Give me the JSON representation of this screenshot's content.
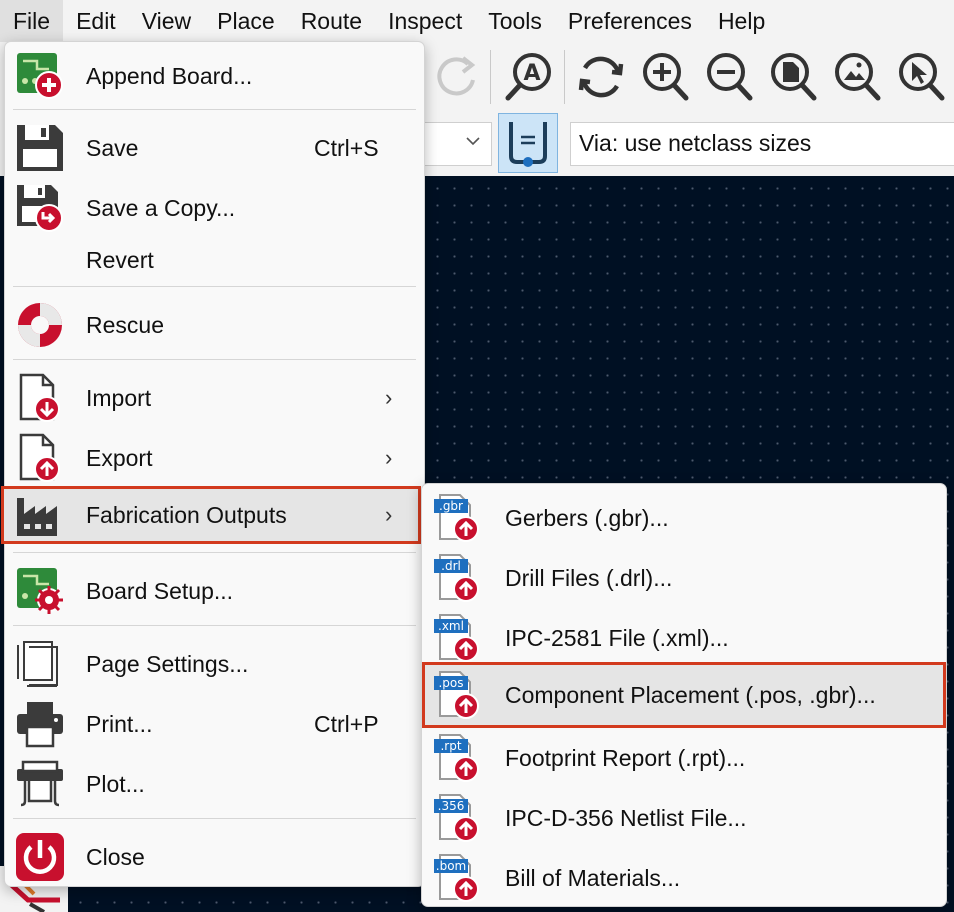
{
  "menubar": {
    "items": [
      {
        "label": "File",
        "name": "menu-file"
      },
      {
        "label": "Edit",
        "name": "menu-edit"
      },
      {
        "label": "View",
        "name": "menu-view"
      },
      {
        "label": "Place",
        "name": "menu-place"
      },
      {
        "label": "Route",
        "name": "menu-route"
      },
      {
        "label": "Inspect",
        "name": "menu-inspect"
      },
      {
        "label": "Tools",
        "name": "menu-tools"
      },
      {
        "label": "Preferences",
        "name": "menu-preferences"
      },
      {
        "label": "Help",
        "name": "menu-help"
      }
    ]
  },
  "toolbar": {
    "icons": [
      "redo-icon",
      "net-inspector-icon",
      "refresh-icon",
      "zoom-in-icon",
      "zoom-out-icon",
      "zoom-page-icon",
      "zoom-objects-icon",
      "zoom-selection-icon"
    ],
    "via_select_value": "Via: use netclass sizes"
  },
  "file_menu": {
    "append_board": "Append Board...",
    "save": "Save",
    "save_shortcut": "Ctrl+S",
    "save_copy": "Save a Copy...",
    "revert": "Revert",
    "rescue": "Rescue",
    "import": "Import",
    "export": "Export",
    "fabrication_outputs": "Fabrication Outputs",
    "board_setup": "Board Setup...",
    "page_settings": "Page Settings...",
    "print": "Print...",
    "print_shortcut": "Ctrl+P",
    "plot": "Plot...",
    "close": "Close",
    "submenu_arrow": "›"
  },
  "fab_submenu": {
    "items": [
      {
        "label": "Gerbers (.gbr)...",
        "badge": ".gbr"
      },
      {
        "label": "Drill Files (.drl)...",
        "badge": ".drl"
      },
      {
        "label": "IPC-2581 File (.xml)...",
        "badge": ".xml"
      },
      {
        "label": "Component Placement (.pos, .gbr)...",
        "badge": ".pos"
      },
      {
        "label": "Footprint Report (.rpt)...",
        "badge": ".rpt"
      },
      {
        "label": "IPC-D-356 Netlist File...",
        "badge": ".356"
      },
      {
        "label": "Bill of Materials...",
        "badge": ".bom"
      }
    ]
  },
  "colors": {
    "highlight_outline": "#d23a1e",
    "canvas_bg": "#001023",
    "export_arrow_red": "#c8102e",
    "badge_blue": "#1e6fbf"
  }
}
